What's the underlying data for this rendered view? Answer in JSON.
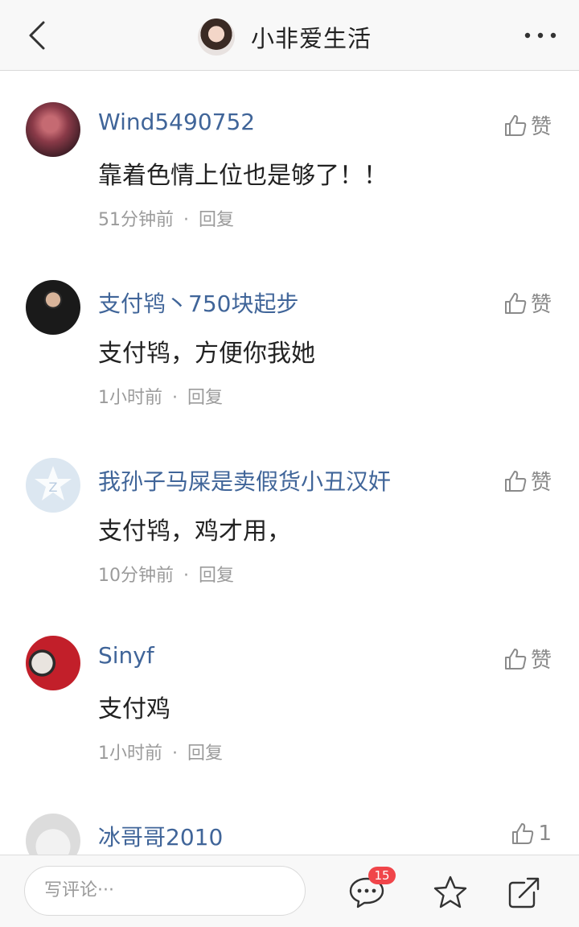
{
  "header": {
    "title": "小非爱生活",
    "back_icon": "chevron-left-icon",
    "more_icon": "more-dots-icon"
  },
  "comments": [
    {
      "username": "Wind5490752",
      "content": "靠着色情上位也是够了！！",
      "time": "51分钟前",
      "reply_label": "回复",
      "like_label": "赞",
      "avatar": "dark-portrait"
    },
    {
      "username": "支付鸨丶750块起步",
      "content": "支付鸨，方便你我她",
      "time": "1小时前",
      "reply_label": "回复",
      "like_label": "赞",
      "avatar": "man-at-podium"
    },
    {
      "username": "我孙子马屎是卖假货小丑汉奸",
      "content": "支付鸨，鸡才用，",
      "time": "10分钟前",
      "reply_label": "回复",
      "like_label": "赞",
      "avatar": "default-star"
    },
    {
      "username": "Sinyf",
      "content": "支付鸡",
      "time": "1小时前",
      "reply_label": "回复",
      "like_label": "赞",
      "avatar": "kfc-style-portrait"
    },
    {
      "username": "冰哥哥2010",
      "like_label": "1",
      "avatar": "gray-placeholder"
    }
  ],
  "meta_separator": "·",
  "bottom_bar": {
    "comment_placeholder": "写评论···",
    "comment_badge": "15",
    "comment_icon": "comment-bubble-icon",
    "favorite_icon": "star-icon",
    "share_icon": "share-icon"
  },
  "colors": {
    "username": "#406599",
    "badge": "#f0454a",
    "meta": "#9b9b9b"
  }
}
